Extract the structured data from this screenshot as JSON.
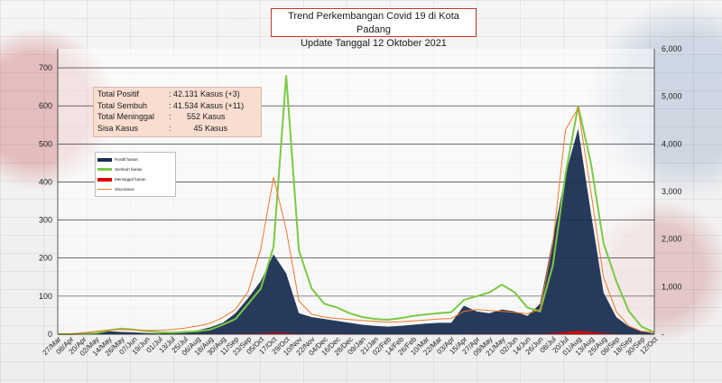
{
  "title": {
    "line1": "Trend Perkembangan Covid 19 di Kota Padang",
    "line2": "Update Tanggal 12 Oktober 2021"
  },
  "summary": [
    {
      "label": "Total Positif",
      "value": ": 42.131 Kasus (+3)"
    },
    {
      "label": "Total Sembuh",
      "value": ": 41.534 Kasus (+11)"
    },
    {
      "label": "Total Meninggal",
      "value": ":       552 Kasus"
    },
    {
      "label": "Sisa Kasus",
      "value": ":          45 Kasus"
    }
  ],
  "legend": [
    {
      "name": "Positif harian",
      "color": "#1b2f52"
    },
    {
      "name": "Sembuh harian",
      "color": "#7ac943"
    },
    {
      "name": "Meninggal harian",
      "color": "#e00000"
    },
    {
      "name": "Sisa kasus",
      "color": "#f07a2a"
    }
  ],
  "chart_data": {
    "type": "area",
    "categories": [
      "27/Mar",
      "08/Apr",
      "20/Apr",
      "02/May",
      "14/May",
      "26/May",
      "07/Jun",
      "19/Jun",
      "01/Jul",
      "13/Jul",
      "25/Jul",
      "06/Aug",
      "18/Aug",
      "30/Aug",
      "11/Sep",
      "23/Sep",
      "05/Oct",
      "17/Oct",
      "29/Oct",
      "10/Nov",
      "22/Nov",
      "04/Dec",
      "16/Dec",
      "28/Dec",
      "09/Jan",
      "21/Jan",
      "02/Feb",
      "14/Feb",
      "26/Feb",
      "10/Mar",
      "22/Mar",
      "03/Apr",
      "15/Apr",
      "27/Apr",
      "09/May",
      "21/May",
      "02/Jun",
      "14/Jun",
      "26/Jun",
      "08/Jul",
      "20/Jul",
      "01/Aug",
      "13/Aug",
      "25/Aug",
      "06/Sep",
      "18/Sep",
      "30/Sep",
      "12/Oct"
    ],
    "yleft": {
      "ticks": [
        "0",
        "100",
        "200",
        "300",
        "400",
        "500",
        "600",
        "700"
      ],
      "ylim": [
        0,
        750
      ]
    },
    "yright": {
      "ticks": [
        "-",
        "1,000",
        "2,000",
        "3,000",
        "4,000",
        "5,000",
        "6,000"
      ],
      "ylim": [
        0,
        6000
      ]
    },
    "series": [
      {
        "name": "Positif harian",
        "axis": "left",
        "color": "#1b2f52",
        "values": [
          0,
          1,
          2,
          5,
          8,
          6,
          5,
          3,
          2,
          4,
          6,
          10,
          18,
          30,
          55,
          95,
          140,
          210,
          160,
          55,
          45,
          40,
          35,
          30,
          25,
          22,
          20,
          22,
          25,
          28,
          30,
          30,
          75,
          60,
          55,
          65,
          60,
          48,
          80,
          250,
          420,
          540,
          320,
          110,
          45,
          20,
          8,
          2
        ]
      },
      {
        "name": "Sembuh harian",
        "axis": "left",
        "color": "#7ac943",
        "values": [
          0,
          0,
          1,
          3,
          10,
          15,
          12,
          8,
          5,
          4,
          6,
          8,
          12,
          25,
          40,
          80,
          120,
          230,
          680,
          220,
          120,
          80,
          70,
          55,
          45,
          40,
          38,
          42,
          48,
          52,
          55,
          58,
          90,
          100,
          110,
          130,
          110,
          70,
          60,
          180,
          420,
          600,
          450,
          240,
          140,
          60,
          20,
          5
        ]
      },
      {
        "name": "Meninggal harian",
        "axis": "left",
        "color": "#e00000",
        "values": [
          0,
          0,
          0,
          0,
          0,
          0,
          0,
          0,
          0,
          0,
          0,
          0,
          0,
          1,
          1,
          2,
          2,
          4,
          3,
          1,
          1,
          1,
          1,
          1,
          0,
          0,
          0,
          0,
          0,
          0,
          0,
          0,
          1,
          1,
          1,
          1,
          1,
          1,
          1,
          3,
          6,
          9,
          6,
          3,
          1,
          0,
          0,
          0
        ]
      },
      {
        "name": "Sisa kasus",
        "axis": "right",
        "color": "#f07a2a",
        "values": [
          0,
          10,
          30,
          60,
          90,
          100,
          90,
          80,
          80,
          100,
          130,
          170,
          230,
          350,
          520,
          900,
          1800,
          3300,
          2200,
          700,
          420,
          360,
          330,
          310,
          290,
          270,
          255,
          260,
          280,
          300,
          320,
          330,
          480,
          520,
          500,
          480,
          460,
          430,
          520,
          1900,
          4300,
          4750,
          3000,
          1200,
          480,
          170,
          60,
          45
        ]
      }
    ]
  }
}
